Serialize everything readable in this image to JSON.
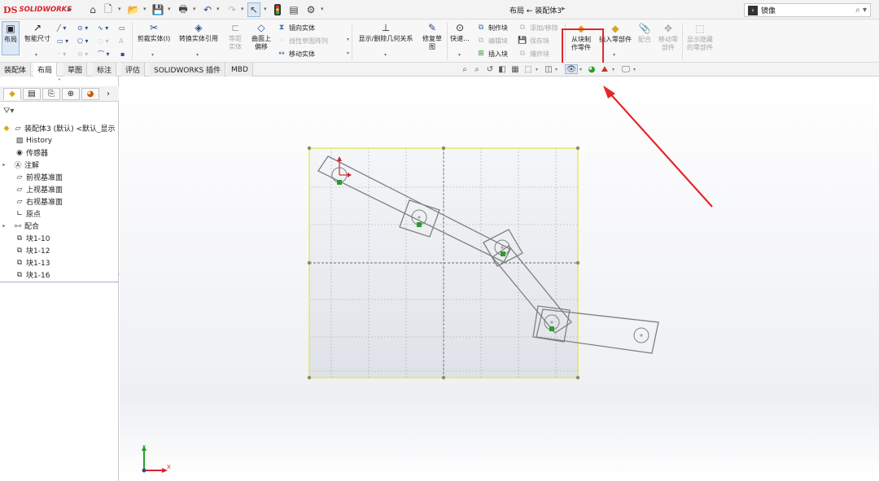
{
  "titlebar": {
    "logo_ds": "DS",
    "logo_text": "SOLIDWORKS",
    "doc_title": "布局 ← 装配体3",
    "search_value": "镜像"
  },
  "command_manager": {
    "layout_btn": "布局",
    "smart_dim_btn": "智能尺寸",
    "trim_btn": "剪裁实体(I)",
    "convert_btn": "转换实体引用",
    "offset_btn": "等距实体",
    "surface_offset_btn_l1": "曲面上",
    "surface_offset_btn_l2": "偏移",
    "mirror_btn": "镜向实体",
    "linear_pattern_btn": "线性草图阵列",
    "move_btn": "移动实体",
    "relations_btn": "显示/删除几何关系",
    "repair_btn_l1": "修复草",
    "repair_btn_l2": "图",
    "quick_btn": "快速...",
    "make_block_btn": "制作块",
    "edit_block_btn": "编辑块",
    "insert_block_btn": "插入块",
    "add_remove_btn": "添加/移除",
    "save_block_btn": "保存块",
    "explode_block_btn": "爆炸块",
    "make_part_btn_l1": "从块制",
    "make_part_btn_l2": "作零件",
    "insert_part_btn": "插入零部件",
    "mate_btn": "配合",
    "move_comp_btn_l1": "移动零",
    "move_comp_btn_l2": "部件",
    "show_hidden_btn_l1": "显示隐藏",
    "show_hidden_btn_l2": "的零部件"
  },
  "tabs": [
    "装配体",
    "布局",
    "草图",
    "标注",
    "评估",
    "SOLIDWORKS 插件",
    "MBD"
  ],
  "active_tab": "布局",
  "feature_tree": {
    "root": "装配体3 (默认) <默认_显示",
    "items": [
      "History",
      "传感器",
      "注解",
      "前视基准面",
      "上视基准面",
      "右视基准面",
      "原点",
      "配合",
      "块1-10",
      "块1-12",
      "块1-13",
      "块1-16"
    ]
  },
  "triad": {
    "y": "Y",
    "x": "X"
  },
  "colors": {
    "accent_red": "#e6262a",
    "sketch_line": "#808080",
    "selection_box": "#e4e43a",
    "fix_marker": "#2a9d2a"
  }
}
